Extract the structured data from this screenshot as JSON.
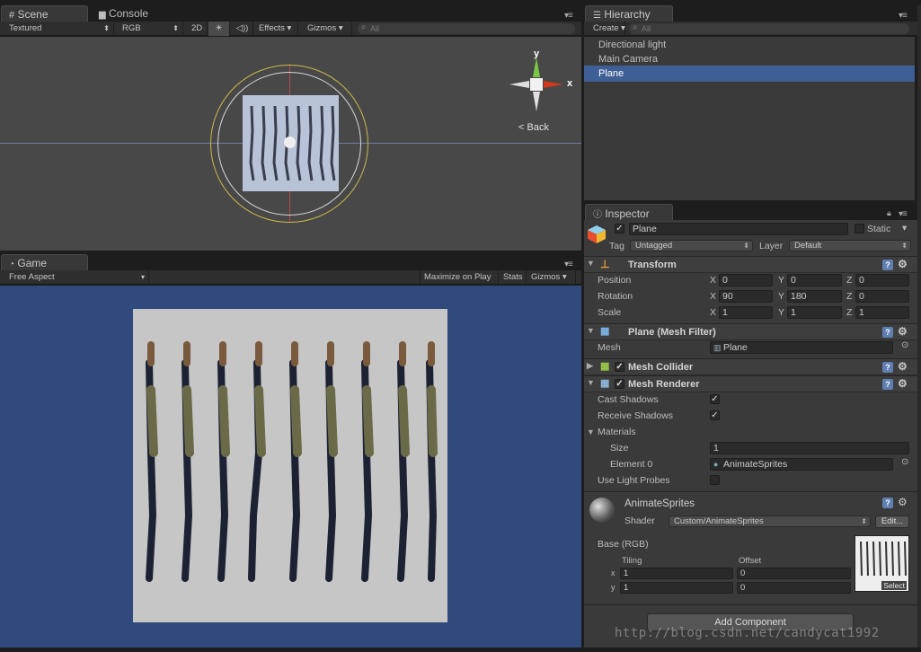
{
  "scene": {
    "tab_label": "Scene",
    "console_tab_label": "Console",
    "toolbar": {
      "shading": "Textured",
      "render_mode": "RGB",
      "mode_2d": "2D",
      "lighting": "☀",
      "audio": "◁))",
      "effects": "Effects",
      "gizmos": "Gizmos",
      "search_placeholder": "All"
    },
    "gizmo": {
      "y_label": "y",
      "x_label": "x",
      "back_label": "Back"
    }
  },
  "game": {
    "tab_label": "Game",
    "aspect": "Free Aspect",
    "maximize_on_play": "Maximize on Play",
    "stats": "Stats",
    "gizmos": "Gizmos"
  },
  "hierarchy": {
    "tab_label": "Hierarchy",
    "create_label": "Create",
    "search_placeholder": "All",
    "items": [
      {
        "label": "Directional light",
        "selected": false
      },
      {
        "label": "Main Camera",
        "selected": false
      },
      {
        "label": "Plane",
        "selected": true
      }
    ]
  },
  "inspector": {
    "tab_label": "Inspector",
    "object_name": "Plane",
    "static_label": "Static",
    "tag_label": "Tag",
    "tag_value": "Untagged",
    "layer_label": "Layer",
    "layer_value": "Default",
    "transform": {
      "title": "Transform",
      "position_label": "Position",
      "rotation_label": "Rotation",
      "scale_label": "Scale",
      "axis_x": "X",
      "axis_y": "Y",
      "axis_z": "Z",
      "position": {
        "x": "0",
        "y": "0",
        "z": "0"
      },
      "rotation": {
        "x": "90",
        "y": "180",
        "z": "0"
      },
      "scale": {
        "x": "1",
        "y": "1",
        "z": "1"
      }
    },
    "mesh_filter": {
      "title": "Plane (Mesh Filter)",
      "mesh_label": "Mesh",
      "mesh_value": "Plane"
    },
    "mesh_collider": {
      "title": "Mesh Collider"
    },
    "mesh_renderer": {
      "title": "Mesh Renderer",
      "cast_shadows_label": "Cast Shadows",
      "receive_shadows_label": "Receive Shadows",
      "materials_label": "Materials",
      "size_label": "Size",
      "size_value": "1",
      "element0_label": "Element 0",
      "element0_value": "AnimateSprites",
      "use_light_probes_label": "Use Light Probes"
    },
    "material": {
      "name": "AnimateSprites",
      "shader_label": "Shader",
      "shader_value": "Custom/AnimateSprites",
      "edit_label": "Edit...",
      "base_label": "Base (RGB)",
      "tiling_label": "Tiling",
      "offset_label": "Offset",
      "x_label": "x",
      "y_label": "y",
      "tiling_x": "1",
      "tiling_y": "1",
      "offset_x": "0",
      "offset_y": "0",
      "select_label": "Select"
    },
    "add_component_label": "Add Component"
  },
  "watermark": "http://blog.csdn.net/candycat1992",
  "icons": {
    "scene_tab": "grid-icon",
    "console_tab": "console-icon",
    "game_tab": "pacman-icon",
    "hierarchy_tab": "list-icon",
    "inspector_tab": "info-icon"
  }
}
